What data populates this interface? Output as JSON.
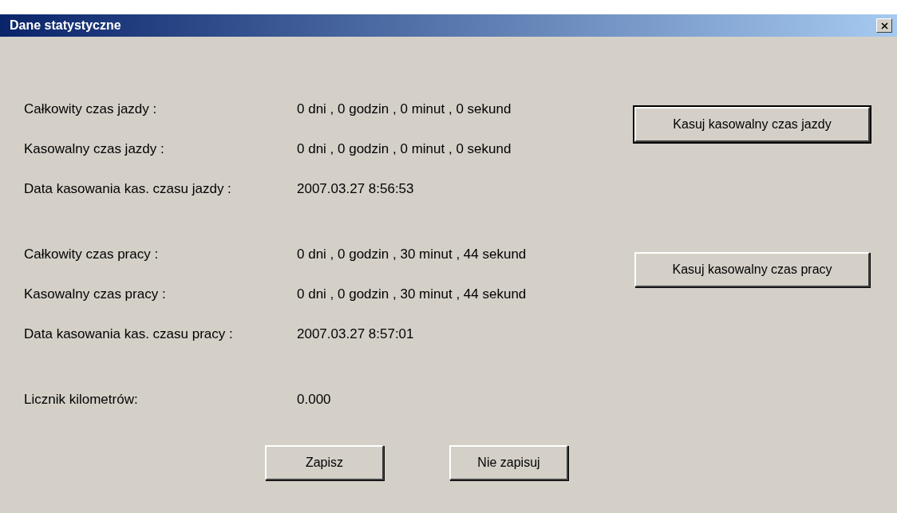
{
  "window": {
    "title": "Dane statystyczne"
  },
  "groups": [
    {
      "rows": [
        {
          "label": "Całkowity czas jazdy :",
          "value": "0 dni , 0 godzin , 0 minut , 0 sekund"
        },
        {
          "label": "Kasowalny czas jazdy :",
          "value": "0 dni , 0 godzin , 0 minut , 0 sekund"
        },
        {
          "label": "Data kasowania kas. czasu jazdy :",
          "value": "2007.03.27 8:56:53"
        }
      ],
      "button": {
        "label": "Kasuj kasowalny czas jazdy",
        "default": true
      }
    },
    {
      "rows": [
        {
          "label": "Całkowity czas pracy :",
          "value": "0 dni , 0 godzin , 30 minut , 44 sekund"
        },
        {
          "label": "Kasowalny czas pracy :",
          "value": "0 dni , 0 godzin , 30 minut , 44 sekund"
        },
        {
          "label": "Data kasowania kas. czasu pracy :",
          "value": "2007.03.27 8:57:01"
        }
      ],
      "button": {
        "label": "Kasuj kasowalny czas pracy",
        "default": false
      }
    },
    {
      "rows": [
        {
          "label": "Licznik kilometrów:",
          "value": "0.000"
        }
      ]
    }
  ],
  "buttons": [
    {
      "label": "Zapisz"
    },
    {
      "label": "Nie zapisuj"
    }
  ]
}
